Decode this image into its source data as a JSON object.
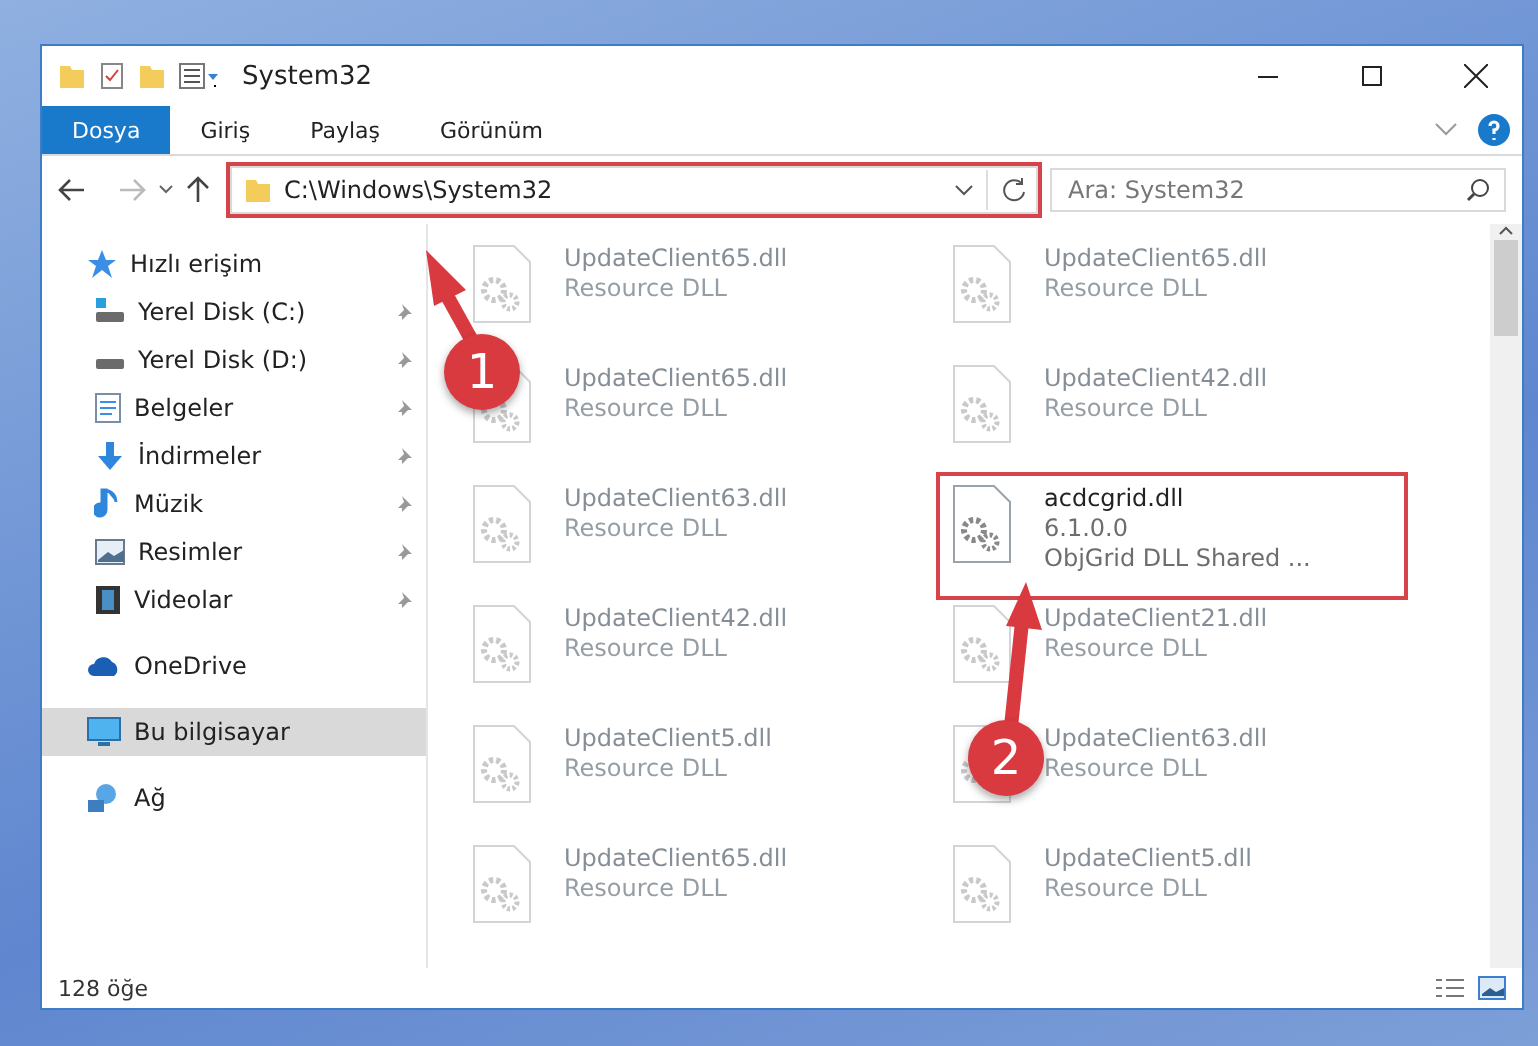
{
  "window": {
    "title": "System32"
  },
  "ribbon_tabs": [
    {
      "label": "Dosya",
      "selected": true
    },
    {
      "label": "Giriş",
      "selected": false
    },
    {
      "label": "Paylaş",
      "selected": false
    },
    {
      "label": "Görünüm",
      "selected": false
    }
  ],
  "address": {
    "path": "C:\\Windows\\System32",
    "marked": true
  },
  "search": {
    "placeholder": "Ara: System32"
  },
  "sidebar": {
    "items": [
      {
        "label": "Hızlı erişim",
        "selected": false,
        "children": [
          {
            "label": "Yerel Disk (C:)",
            "pinned": true
          },
          {
            "label": "Yerel Disk (D:)",
            "pinned": true
          },
          {
            "label": "Belgeler",
            "pinned": true
          },
          {
            "label": "İndirmeler",
            "pinned": true
          },
          {
            "label": "Müzik",
            "pinned": true
          },
          {
            "label": "Resimler",
            "pinned": true
          },
          {
            "label": "Videolar",
            "pinned": true
          }
        ]
      },
      {
        "label": "OneDrive",
        "selected": false
      },
      {
        "label": "Bu bilgisayar",
        "selected": true
      },
      {
        "label": "Ağ",
        "selected": false
      }
    ]
  },
  "files": [
    {
      "name": "UpdateClient65.dll",
      "lines": [
        "Resource DLL"
      ],
      "faded": true,
      "marked": false
    },
    {
      "name": "UpdateClient65.dll",
      "lines": [
        "Resource DLL"
      ],
      "faded": true,
      "marked": false
    },
    {
      "name": "UpdateClient65.dll",
      "lines": [
        "Resource DLL"
      ],
      "faded": true,
      "marked": false
    },
    {
      "name": "UpdateClient42.dll",
      "lines": [
        "Resource DLL"
      ],
      "faded": true,
      "marked": false
    },
    {
      "name": "UpdateClient63.dll",
      "lines": [
        "Resource DLL"
      ],
      "faded": true,
      "marked": false
    },
    {
      "name": "acdcgrid.dll",
      "lines": [
        "6.1.0.0",
        "ObjGrid DLL Shared ..."
      ],
      "faded": false,
      "marked": true
    },
    {
      "name": "UpdateClient42.dll",
      "lines": [
        "Resource DLL"
      ],
      "faded": true,
      "marked": false
    },
    {
      "name": "UpdateClient21.dll",
      "lines": [
        "Resource DLL"
      ],
      "faded": true,
      "marked": false
    },
    {
      "name": "UpdateClient5.dll",
      "lines": [
        "Resource DLL"
      ],
      "faded": true,
      "marked": false
    },
    {
      "name": "UpdateClient63.dll",
      "lines": [
        "Resource DLL"
      ],
      "faded": true,
      "marked": false
    },
    {
      "name": "UpdateClient65.dll",
      "lines": [
        "Resource DLL"
      ],
      "faded": true,
      "marked": false
    },
    {
      "name": "UpdateClient5.dll",
      "lines": [
        "Resource DLL"
      ],
      "faded": true,
      "marked": false
    }
  ],
  "status_bar": {
    "count": "128 öğe"
  },
  "annotations": [
    {
      "label": "1"
    },
    {
      "label": "2"
    }
  ]
}
